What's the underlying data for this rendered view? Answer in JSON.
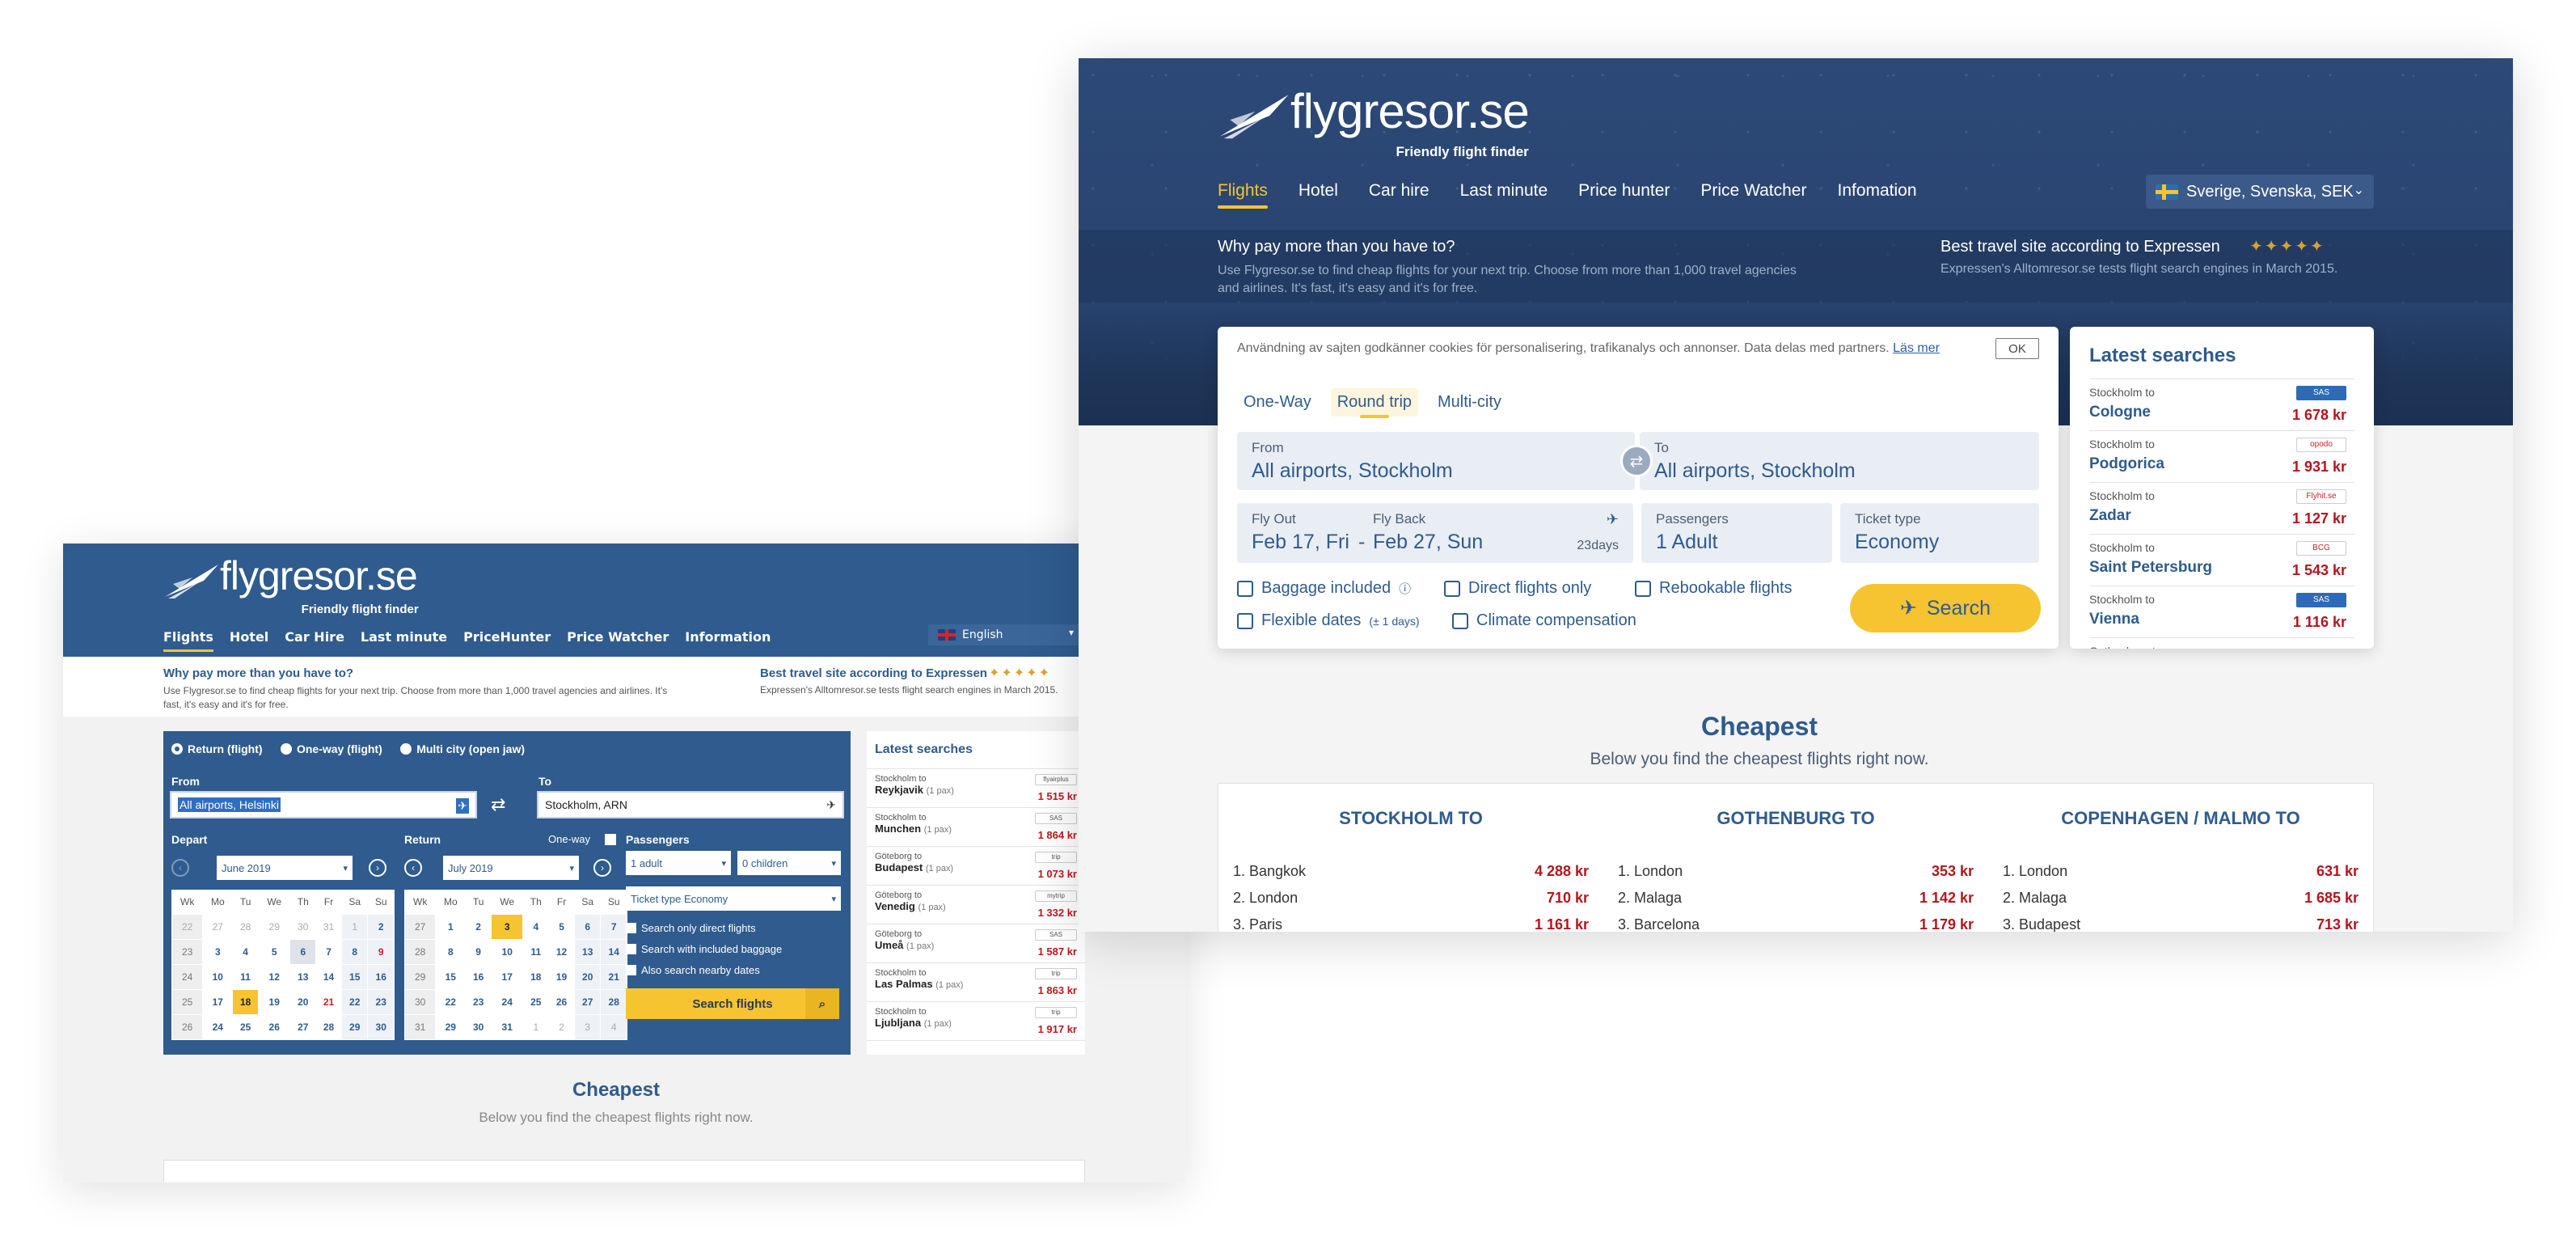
{
  "old_site": {
    "logo": {
      "word": "flygresor.se",
      "tagline": "Friendly flight finder"
    },
    "nav": [
      "Flights",
      "Hotel",
      "Car Hire",
      "Last minute",
      "PriceHunter",
      "Price Watcher",
      "Information"
    ],
    "language": "English",
    "promo": {
      "heading": "Why pay more than you have to?",
      "text": "Use Flygresor.se to find cheap flights for your next trip. Choose from more than 1,000 travel agencies and airlines. It's fast, it's easy and it's for free.",
      "award_heading": "Best travel site according to Expressen",
      "award_text": "Expressen's Alltomresor.se tests flight search engines in March 2015."
    },
    "trip_types": [
      "Return (flight)",
      "One-way (flight)",
      "Multi city (open jaw)"
    ],
    "from_label": "From",
    "from_value": "All airports, Helsinki",
    "to_label": "To",
    "to_value": "Stockholm, ARN",
    "depart_label": "Depart",
    "return_label": "Return",
    "oneway_label": "One-way",
    "passengers_label": "Passengers",
    "depart_month": "June 2019",
    "return_month": "July 2019",
    "adults": "1 adult",
    "children": "0 children",
    "ticket_type": "Ticket type  Economy",
    "weekdays": [
      "Wk",
      "Mo",
      "Tu",
      "We",
      "Th",
      "Fr",
      "Sa",
      "Su"
    ],
    "cal_june": [
      [
        "22",
        "27",
        "28",
        "29",
        "30",
        "31",
        "1",
        "2"
      ],
      [
        "23",
        "3",
        "4",
        "5",
        "6",
        "7",
        "8",
        "9"
      ],
      [
        "24",
        "10",
        "11",
        "12",
        "13",
        "14",
        "15",
        "16"
      ],
      [
        "25",
        "17",
        "18",
        "19",
        "20",
        "21",
        "22",
        "23"
      ],
      [
        "26",
        "24",
        "25",
        "26",
        "27",
        "28",
        "29",
        "30"
      ]
    ],
    "cal_july": [
      [
        "27",
        "1",
        "2",
        "3",
        "4",
        "5",
        "6",
        "7"
      ],
      [
        "28",
        "8",
        "9",
        "10",
        "11",
        "12",
        "13",
        "14"
      ],
      [
        "29",
        "15",
        "16",
        "17",
        "18",
        "19",
        "20",
        "21"
      ],
      [
        "30",
        "22",
        "23",
        "24",
        "25",
        "26",
        "27",
        "28"
      ],
      [
        "31",
        "29",
        "30",
        "31",
        "1",
        "2",
        "3",
        "4"
      ]
    ],
    "options": [
      "Search only direct flights",
      "Search with included baggage",
      "Also search nearby dates"
    ],
    "search_button": "Search flights",
    "latest_heading": "Latest searches",
    "latest": [
      {
        "from": "Stockholm to",
        "city": "Reykjavik",
        "pax": "(1 pax)",
        "airline": "flyairplus",
        "price": "1 515 kr"
      },
      {
        "from": "Stockholm to",
        "city": "Munchen",
        "pax": "(1 pax)",
        "airline": "SAS",
        "price": "1 864 kr"
      },
      {
        "from": "Göteborg to",
        "city": "Budapest",
        "pax": "(1 pax)",
        "airline": "trip",
        "price": "1 073 kr"
      },
      {
        "from": "Göteborg to",
        "city": "Venedig",
        "pax": "(1 pax)",
        "airline": "mytrip",
        "price": "1 332 kr"
      },
      {
        "from": "Göteborg to",
        "city": "Umeå",
        "pax": "(1 pax)",
        "airline": "SAS",
        "price": "1 587 kr"
      },
      {
        "from": "Stockholm to",
        "city": "Las Palmas",
        "pax": "(1 pax)",
        "airline": "trip",
        "price": "1 863 kr"
      },
      {
        "from": "Stockholm to",
        "city": "Ljubljana",
        "pax": "(1 pax)",
        "airline": "trip",
        "price": "1 917 kr"
      }
    ],
    "cheapest_heading": "Cheapest",
    "cheapest_sub": "Below you find the cheapest flights right now."
  },
  "new_site": {
    "logo": {
      "word": "flygresor.se",
      "tagline": "Friendly flight finder"
    },
    "nav": [
      "Flights",
      "Hotel",
      "Car hire",
      "Last minute",
      "Price hunter",
      "Price Watcher",
      "Infomation"
    ],
    "language": "Sverige, Svenska, SEK",
    "promo": {
      "heading": "Why pay more than you have to?",
      "text": "Use Flygresor.se to find cheap flights for your next trip. Choose from more than 1,000 travel agencies and airlines. It's fast, it's easy and it's for free.",
      "award_heading": "Best travel site according to Expressen",
      "award_text": "Expressen's Alltomresor.se tests flight search engines in March 2015."
    },
    "cookie_text": "Användning av sajten godkänner cookies för personalisering, trafikanalys och annonser. Data delas med partners.",
    "cookie_link": "Läs mer",
    "cookie_ok": "OK",
    "tabs": [
      "One-Way",
      "Round trip",
      "Multi-city"
    ],
    "from_label": "From",
    "from_value": "All airports, Stockholm",
    "to_label": "To",
    "to_value": "All airports, Stockholm",
    "flyout_label": "Fly Out",
    "flyout_value": "Feb 17, Fri",
    "dash": "-",
    "flyback_label": "Fly Back",
    "flyback_value": "Feb 27, Sun",
    "days": "23days",
    "passengers_label": "Passengers",
    "passengers_value": "1 Adult",
    "ticket_label": "Ticket type",
    "ticket_value": "Economy",
    "options": [
      "Baggage included",
      "Direct flights only",
      "Rebookable flights",
      "Flexible dates",
      "Climate compensation"
    ],
    "flex_note": "(± 1 days)",
    "search_button": "Search",
    "latest_heading": "Latest searches",
    "latest": [
      {
        "from": "Stockholm to",
        "city": "Cologne",
        "airline": "SAS",
        "price": "1 678 kr"
      },
      {
        "from": "Stockholm to",
        "city": "Podgorica",
        "airline": "opodo",
        "price": "1 931 kr"
      },
      {
        "from": "Stockholm to",
        "city": "Zadar",
        "airline": "Flyhit.se",
        "price": "1 127 kr"
      },
      {
        "from": "Stockholm to",
        "city": "Saint Petersburg",
        "airline": "BCG",
        "price": "1 543 kr"
      },
      {
        "from": "Stockholm to",
        "city": "Vienna",
        "airline": "SAS",
        "price": "1 116 kr"
      },
      {
        "from": "Gothenburg to",
        "city": "",
        "airline": "",
        "price": ""
      }
    ],
    "cheapest_heading": "Cheapest",
    "cheapest_sub": "Below you find the cheapest flights right now.",
    "columns": [
      {
        "title": "STOCKHOLM TO",
        "rows": [
          [
            "1. Bangkok",
            "4 288 kr"
          ],
          [
            "2. London",
            "710 kr"
          ],
          [
            "3. Paris",
            "1 161 kr"
          ]
        ]
      },
      {
        "title": "GOTHENBURG TO",
        "rows": [
          [
            "1. London",
            "353 kr"
          ],
          [
            "2. Malaga",
            "1 142 kr"
          ],
          [
            "3. Barcelona",
            "1 179 kr"
          ]
        ]
      },
      {
        "title": "COPENHAGEN / MALMO TO",
        "rows": [
          [
            "1. London",
            "631 kr"
          ],
          [
            "2. Malaga",
            "1 685 kr"
          ],
          [
            "3. Budapest",
            "713 kr"
          ]
        ]
      }
    ]
  },
  "colors": {
    "navy": "#2f5b8e",
    "accent_yellow": "#f6c431",
    "price_red": "#b5151c"
  }
}
